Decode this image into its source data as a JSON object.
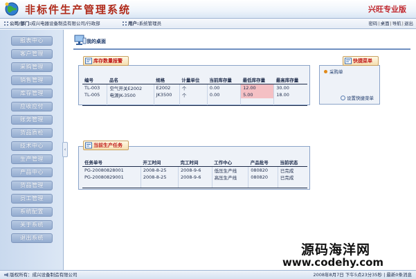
{
  "header": {
    "title": "非标件生产管理系统",
    "edition": "兴旺专业版"
  },
  "infobar": {
    "company_label": "公司/部门:",
    "company_value": "成兴电器设备制造有限公司/行政部",
    "user_label": "用户:",
    "user_value": "系统管理员",
    "links": [
      "密码",
      "桌面",
      "导航",
      "退出"
    ]
  },
  "sidebar": {
    "items": [
      "报表中心",
      "客户管理",
      "采购管理",
      "销售管理",
      "库存管理",
      "应收应付",
      "账务管理",
      "货品质检",
      "技术中心",
      "生产管理",
      "产品中心",
      "货品管理",
      "员工管理",
      "系统配置",
      "关于系统",
      "退出系统"
    ]
  },
  "desk": {
    "title": "我的桌面"
  },
  "stock_panel": {
    "title": "库存数量报警",
    "columns": [
      "编号",
      "品名",
      "规格",
      "计量单位",
      "当前库存量",
      "最低库存量",
      "最高库存量"
    ],
    "rows": [
      [
        "TL-003",
        "空气开关E2002",
        "E2002",
        "个",
        "0.00",
        "12.00",
        "30.00"
      ],
      [
        "TL-005",
        "电源JK-3500",
        "JK3500",
        "个",
        "0.00",
        "5.00",
        "18.00"
      ]
    ]
  },
  "tasks_panel": {
    "title": "当前生产任务",
    "columns": [
      "任务单号",
      "开工时间",
      "完工时间",
      "工作中心",
      "产品批号",
      "当前状态"
    ],
    "rows": [
      [
        "PG-20080828001",
        "2008-8-25",
        "2008-9-6",
        "低压生产线",
        "080820",
        "已完成"
      ],
      [
        "PG-20080829001",
        "2008-8-25",
        "2008-9-6",
        "高压生产线",
        "080820",
        "已完成"
      ]
    ]
  },
  "quick_panel": {
    "title": "快捷菜单",
    "items": [
      "采购单"
    ],
    "setting": "设置快捷菜单"
  },
  "statusbar": {
    "left": "版权所有：成兴设备制造有限公司",
    "right": "2008年8月7日  下午5点23分35秒 | 最新0条消息"
  },
  "watermark": {
    "line1": "源码海洋网",
    "line2": "www.codehy.com"
  },
  "colors": {
    "menu_button": "#93acd0",
    "alert_title": "#c01818",
    "warn_cell": "#f4c0c4",
    "border": "#8aa3c8"
  }
}
